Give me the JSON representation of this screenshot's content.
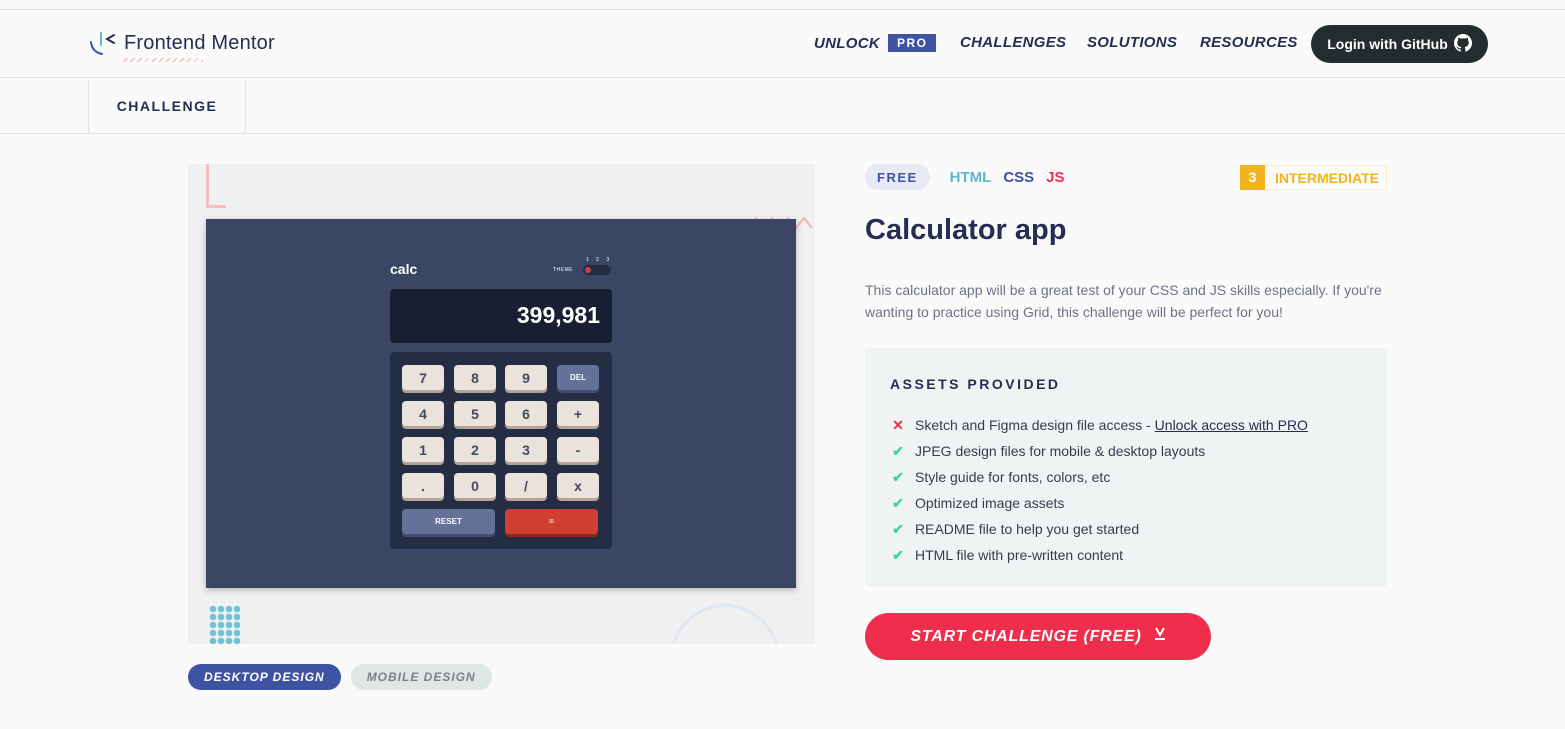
{
  "header": {
    "logo_text": "Frontend Mentor",
    "nav": {
      "unlock_label": "UNLOCK",
      "pro_badge": "PRO",
      "challenges": "CHALLENGES",
      "solutions": "SOLUTIONS",
      "resources": "RESOURCES"
    },
    "login_button": "Login with GitHub",
    "login_icon": "github-icon"
  },
  "subnav": {
    "active_tab": "CHALLENGE"
  },
  "preview": {
    "calc_title": "calc",
    "theme_label": "THEME",
    "theme_numbers": "1 2 3",
    "display_value": "399,981",
    "keys": [
      {
        "label": "7",
        "kind": "std"
      },
      {
        "label": "8",
        "kind": "std"
      },
      {
        "label": "9",
        "kind": "std"
      },
      {
        "label": "DEL",
        "kind": "blue"
      },
      {
        "label": "4",
        "kind": "std"
      },
      {
        "label": "5",
        "kind": "std"
      },
      {
        "label": "6",
        "kind": "std"
      },
      {
        "label": "+",
        "kind": "std"
      },
      {
        "label": "1",
        "kind": "std"
      },
      {
        "label": "2",
        "kind": "std"
      },
      {
        "label": "3",
        "kind": "std"
      },
      {
        "label": "-",
        "kind": "std"
      },
      {
        "label": ".",
        "kind": "std"
      },
      {
        "label": "0",
        "kind": "std"
      },
      {
        "label": "/",
        "kind": "std"
      },
      {
        "label": "x",
        "kind": "std"
      },
      {
        "label": "RESET",
        "kind": "blue"
      },
      {
        "label": "=",
        "kind": "red"
      }
    ]
  },
  "design_tabs": {
    "desktop": "DESKTOP DESIGN",
    "mobile": "MOBILE DESIGN"
  },
  "challenge": {
    "price_badge": "FREE",
    "languages": [
      {
        "label": "HTML",
        "color": "#5fb7cf"
      },
      {
        "label": "CSS",
        "color": "#3e54a3"
      },
      {
        "label": "JS",
        "color": "#ef2e4d"
      }
    ],
    "level_number": "3",
    "level_label": "INTERMEDIATE",
    "title": "Calculator app",
    "description": "This calculator app will be a great test of your CSS and JS skills especially. If you're wanting to practice using Grid, this challenge will be perfect for you!",
    "assets_title": "ASSETS PROVIDED",
    "assets": [
      {
        "icon": "cross-icon",
        "text": "Sketch and Figma design file access - ",
        "link": "Unlock access with PRO"
      },
      {
        "icon": "check-icon",
        "text": "JPEG design files for mobile & desktop layouts"
      },
      {
        "icon": "check-icon",
        "text": "Style guide for fonts, colors, etc"
      },
      {
        "icon": "check-icon",
        "text": "Optimized image assets"
      },
      {
        "icon": "check-icon",
        "text": "README file to help you get started"
      },
      {
        "icon": "check-icon",
        "text": "HTML file with pre-written content"
      }
    ],
    "start_button": "START CHALLENGE (FREE)",
    "start_icon": "download-arrow-icon"
  },
  "colors": {
    "primary_blue": "#3e54a3",
    "accent_red": "#ef2e4d",
    "level_yellow": "#f2b41c",
    "check_green": "#3dd598",
    "cross_red": "#ef2e4d"
  }
}
